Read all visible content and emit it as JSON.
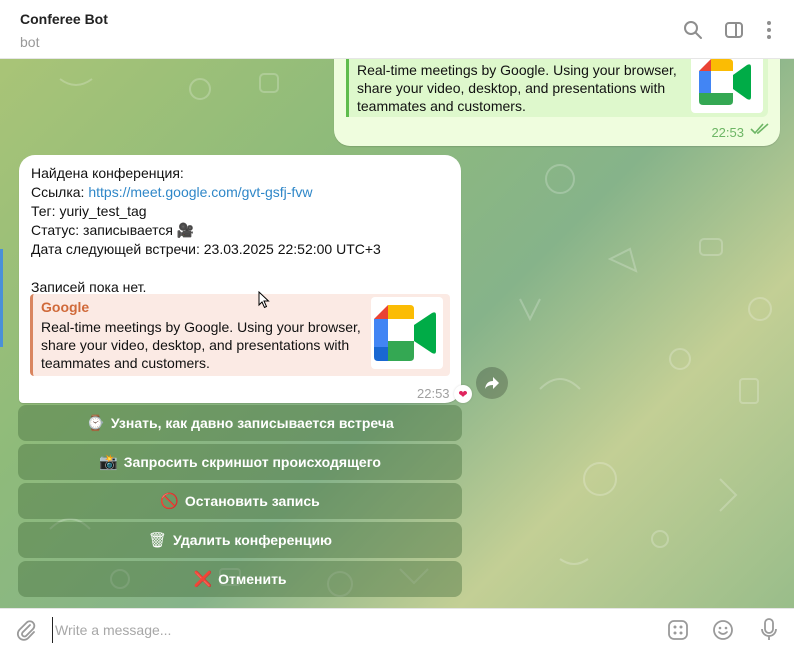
{
  "header": {
    "title": "Conferee Bot",
    "subtitle": "bot",
    "icons": [
      "search-icon",
      "sidebar-toggle-icon",
      "more-vertical-icon"
    ]
  },
  "outgoing_message": {
    "preview_text": "Real-time meetings by Google. Using your browser, share your video, desktop, and presentations with teammates and customers.",
    "time": "22:53",
    "status": "read"
  },
  "incoming_message": {
    "lines": {
      "found": "Найдена конференция:",
      "link_label": "Ссылка: ",
      "link_url": "https://meet.google.com/gvt-gsfj-fvw",
      "tag": "Тег: yuriy_test_tag",
      "status": "Статус: записывается ",
      "status_emoji": "🎥",
      "next_meeting": "Дата следующей встречи: 23.03.2025 22:52:00 UTC+3",
      "no_records": "Записей пока нет."
    },
    "preview": {
      "site": "Google",
      "text": "Real-time meetings by Google. Using your browser, share your video, desktop, and presentations with teammates and customers."
    },
    "time": "22:53",
    "reaction": "❤"
  },
  "keyboard": {
    "buttons": [
      {
        "emoji": "⌚",
        "label": "Узнать, как давно записывается встреча"
      },
      {
        "emoji": "📸",
        "label": "Запросить скриншот происходящего"
      },
      {
        "emoji": "🚫",
        "label": "Остановить запись"
      },
      {
        "emoji": "🗑",
        "label": "Удалить конференцию"
      },
      {
        "emoji": "❌",
        "label": "Отменить"
      }
    ]
  },
  "composer": {
    "placeholder": "Write a message..."
  },
  "colors": {
    "link": "#2f87c8",
    "preview_accent": "#d9855f",
    "outgoing_bubble": "#effdde",
    "read_checks": "#6db665"
  }
}
